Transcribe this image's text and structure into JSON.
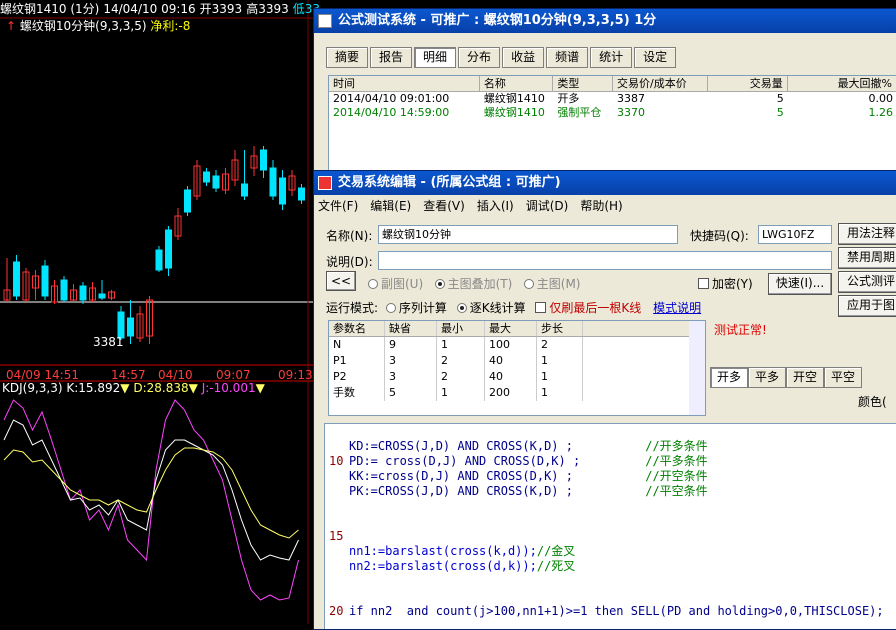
{
  "chart": {
    "symbol": "螺纹钢1410 (1分)",
    "date_time": "14/04/10 09:16",
    "open": "开3393",
    "high": "高3393",
    "low": "低33",
    "indicator_title": "螺纹钢10分钟(9,3,3,5)",
    "net_profit": "净利:-8",
    "low_marker": "3381",
    "time_labels": [
      "04/09 14:51",
      "14:57",
      "04/10",
      "09:07",
      "09:13"
    ],
    "kdj_name": "KDJ(9,3,3)",
    "kdj_k": "K:15.892",
    "kdj_d": "D:28.838",
    "kdj_j": "J:-10.001",
    "colors": {
      "up": "#00e5ff",
      "down": "#ff3333",
      "k": "#ffffff",
      "d": "#ffff66",
      "j": "#ff44ff"
    }
  },
  "test_window": {
    "title": "公式测试系统 - 可推广 : 螺纹钢10分钟(9,3,3,5) 1分",
    "tabs": [
      "摘要",
      "报告",
      "明细",
      "分布",
      "收益",
      "频谱",
      "统计",
      "设定"
    ],
    "selected_tab": "明细",
    "columns": [
      "时间",
      "名称",
      "类型",
      "交易价/成本价",
      "交易量",
      "最大回撤%"
    ],
    "rows": [
      {
        "time": "2014/04/10 09:01:00",
        "name": "螺纹钢1410",
        "type": "开多",
        "price": "3387",
        "qty": "5",
        "dd": "0.00",
        "color": "#000000"
      },
      {
        "time": "2014/04/10 14:59:00",
        "name": "螺纹钢1410",
        "type": "强制平仓",
        "price": "3370",
        "qty": "5",
        "dd": "1.26",
        "color": "#008000"
      }
    ]
  },
  "editor_window": {
    "title": "交易系统编辑 - (所属公式组 : 可推广)",
    "menu": [
      "文件(F)",
      "编辑(E)",
      "查看(V)",
      "插入(I)",
      "调试(D)",
      "帮助(H)"
    ],
    "name_label": "名称(N):",
    "name_value": "螺纹钢10分钟",
    "shortcut_label": "快捷码(Q):",
    "shortcut_value": "LWG10FZ",
    "desc_label": "说明(D):",
    "desc_value": "",
    "right_buttons": [
      "用法注释",
      "禁用周期",
      "公式测评",
      "应用于图"
    ],
    "collapse_btn": "<<",
    "overlay_opts": [
      "副图(U)",
      "主图叠加(T)",
      "主图(M)"
    ],
    "encrypt_label": "加密(Y)",
    "quick_btn": "快速(I)...",
    "run_mode_label": "运行模式:",
    "run_modes": [
      "序列计算",
      "逐K线计算"
    ],
    "last_bar_label": "仅刷最后一根K线",
    "mode_help": "模式说明",
    "status_text": "测试正常!",
    "param_columns": [
      "参数名",
      "缺省",
      "最小",
      "最大",
      "步长"
    ],
    "params": [
      {
        "name": "N",
        "def": "9",
        "min": "1",
        "max": "100",
        "step": "2"
      },
      {
        "name": "P1",
        "def": "3",
        "min": "2",
        "max": "40",
        "step": "1"
      },
      {
        "name": "P2",
        "def": "3",
        "min": "2",
        "max": "40",
        "step": "1"
      },
      {
        "name": "手数",
        "def": "5",
        "min": "1",
        "max": "200",
        "step": "1"
      }
    ],
    "signal_tabs": [
      "开多",
      "平多",
      "开空",
      "平空"
    ],
    "color_label": "颜色(",
    "code_lines": [
      {
        "num": "",
        "code": "KD:=CROSS(J,D) AND CROSS(K,D) ;",
        "comment": "//开多条件"
      },
      {
        "num": "10",
        "code": "PD:= cross(D,J) AND CROSS(D,K) ;",
        "comment": "//平多条件"
      },
      {
        "num": "",
        "code": "KK:=cross(D,J) AND CROSS(D,K) ;",
        "comment": "//开空条件"
      },
      {
        "num": "",
        "code": "PK:=CROSS(J,D) AND CROSS(K,D) ;",
        "comment": "//平空条件"
      },
      {
        "num": "15",
        "code": "",
        "comment": ""
      },
      {
        "num": "",
        "code": "nn1:=barslast(cross(k,d));",
        "comment": "//金叉"
      },
      {
        "num": "",
        "code": "nn2:=barslast(cross(d,k));",
        "comment": "//死叉"
      },
      {
        "num": "20",
        "code": "if nn2  and count(j>100,nn1+1)>=1 then SELL(PD and holding>0,0,THISCLOSE);",
        "comment": ""
      }
    ]
  }
}
